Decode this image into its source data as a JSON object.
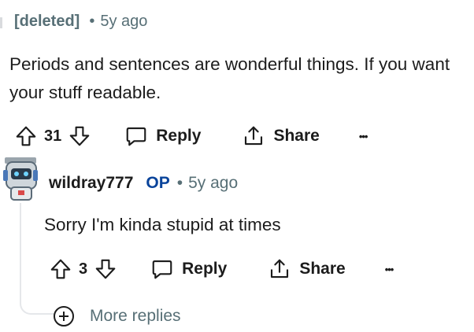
{
  "top_comment": {
    "author": "[deleted]",
    "separator": "•",
    "time": "5y ago",
    "body": "Periods and sentences are wonderful things. If you want your stuff readable.",
    "votes": "31",
    "reply_label": "Reply",
    "share_label": "Share",
    "more_label": "•••"
  },
  "reply_comment": {
    "author": "wildray777",
    "op_badge": "OP",
    "separator": "•",
    "time": "5y ago",
    "body": "Sorry I'm kinda stupid at times",
    "votes": "3",
    "reply_label": "Reply",
    "share_label": "Share",
    "more_label": "•••"
  },
  "more_replies": {
    "label": "More replies"
  },
  "icons": {
    "upvote": "upvote-arrow-icon",
    "downvote": "downvote-arrow-icon",
    "reply": "speech-bubble-icon",
    "share": "share-upload-icon",
    "more": "ellipsis-icon",
    "expand": "plus-circle-icon"
  },
  "colors": {
    "text": "#1c1c1c",
    "meta": "#576f76",
    "op_badge": "#0a449b",
    "thread_line": "#e5e7ea"
  }
}
